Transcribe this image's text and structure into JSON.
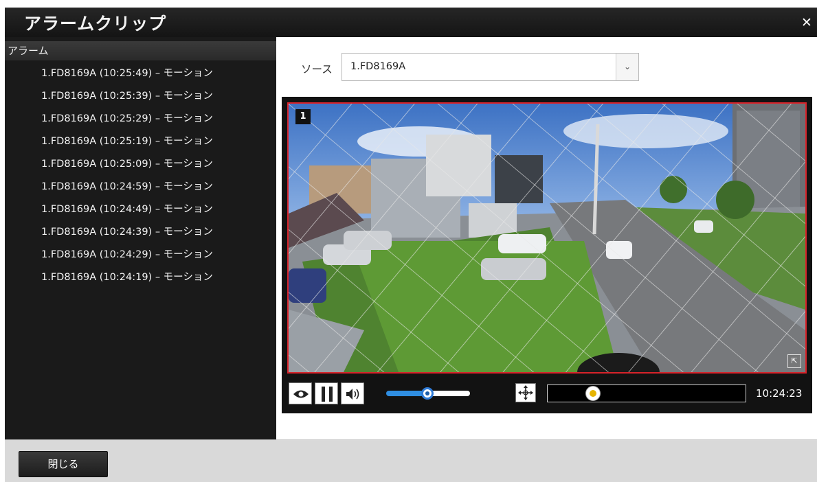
{
  "dialog": {
    "title": "アラームクリップ",
    "close_icon": "close-icon"
  },
  "alarm_panel": {
    "header": "アラーム",
    "items": [
      {
        "label": "1.FD8169A (10:25:49) – モーション"
      },
      {
        "label": "1.FD8169A (10:25:39) – モーション"
      },
      {
        "label": "1.FD8169A (10:25:29) – モーション"
      },
      {
        "label": "1.FD8169A (10:25:19) – モーション"
      },
      {
        "label": "1.FD8169A (10:25:09) – モーション"
      },
      {
        "label": "1.FD8169A (10:24:59) – モーション"
      },
      {
        "label": "1.FD8169A (10:24:49) – モーション"
      },
      {
        "label": "1.FD8169A (10:24:39) – モーション"
      },
      {
        "label": "1.FD8169A (10:24:29) – モーション"
      },
      {
        "label": "1.FD8169A (10:24:19) – モーション"
      }
    ]
  },
  "source": {
    "label": "ソース",
    "selected": "1.FD8169A"
  },
  "player": {
    "camera_number": "1",
    "timestamp": "10:24:23",
    "volume_fraction": 0.49,
    "timeline_fraction": 0.23,
    "icons": [
      "eye-icon",
      "pause-icon",
      "speaker-icon",
      "ptz-move-icon",
      "fullscreen-icon"
    ],
    "colors": {
      "frame_border": "#d8232a",
      "volume_accent": "#2f8ee2",
      "timeline_knob": "#e6b400"
    }
  },
  "footer": {
    "close_label": "閉じる"
  }
}
